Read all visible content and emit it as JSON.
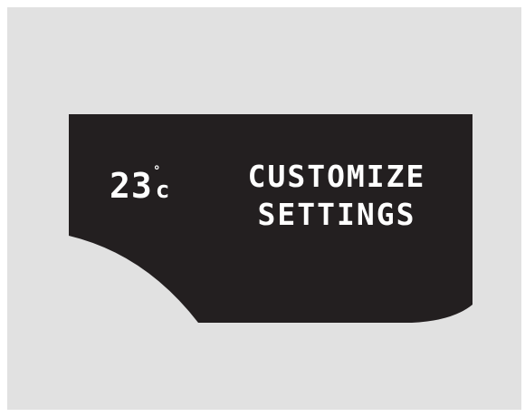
{
  "display": {
    "temperature_value": "23",
    "temperature_degree": "°",
    "temperature_unit": "c",
    "message_line1": "CUSTOMIZE",
    "message_line2": "SETTINGS"
  },
  "colors": {
    "background": "#e1e1e1",
    "screen": "#231f20",
    "text": "#ffffff"
  }
}
